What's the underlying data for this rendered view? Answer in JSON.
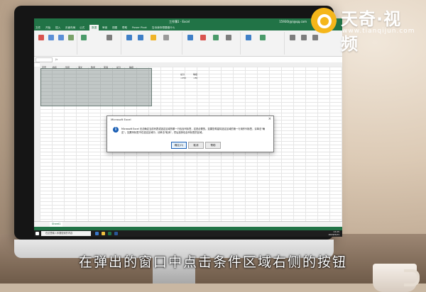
{
  "excel": {
    "title": "工作簿1 - Excel",
    "user": "15930(@)@qq.com",
    "window_controls": "— ❐ ✕",
    "tabs": [
      "文件",
      "开始",
      "插入",
      "页面布局",
      "公式",
      "数据",
      "审阅",
      "视图",
      "帮助",
      "Power Pivot"
    ],
    "active_tab": "数据",
    "tell_me": "告诉我你想要做什么",
    "name_box": "",
    "formula_value": "",
    "sheet_tab": "Sheet1",
    "taskbar_search": "在这里输入你要搜索的内容",
    "clock_time": "13:25",
    "clock_date": "2019/5/21",
    "headers": [
      "序号",
      "姓名",
      "性别",
      "语文",
      "数学",
      "英语",
      "总分",
      "等级"
    ],
    "criteria": [
      [
        "总分",
        "等级"
      ],
      [
        ">250",
        ">80"
      ]
    ]
  },
  "dialog": {
    "title": "Microsoft Excel",
    "message": "Microsoft Excel 无法确定当前列表或选定区域的哪一行包含列标签，这是必需的。如果您希望将选定区域的第一行用作列标签，请单击\"确定\"。如果列标签不在选定区域中，请单击\"取消\"，然后选择包含列标签的区域。",
    "buttons": [
      "确定(O)",
      "取消",
      "帮助"
    ]
  },
  "watermark": {
    "brand": "天奇·视频",
    "url": "www.tianqijun.com"
  },
  "subtitle": "在弹出的窗口中点击条件区域右侧的按钮"
}
